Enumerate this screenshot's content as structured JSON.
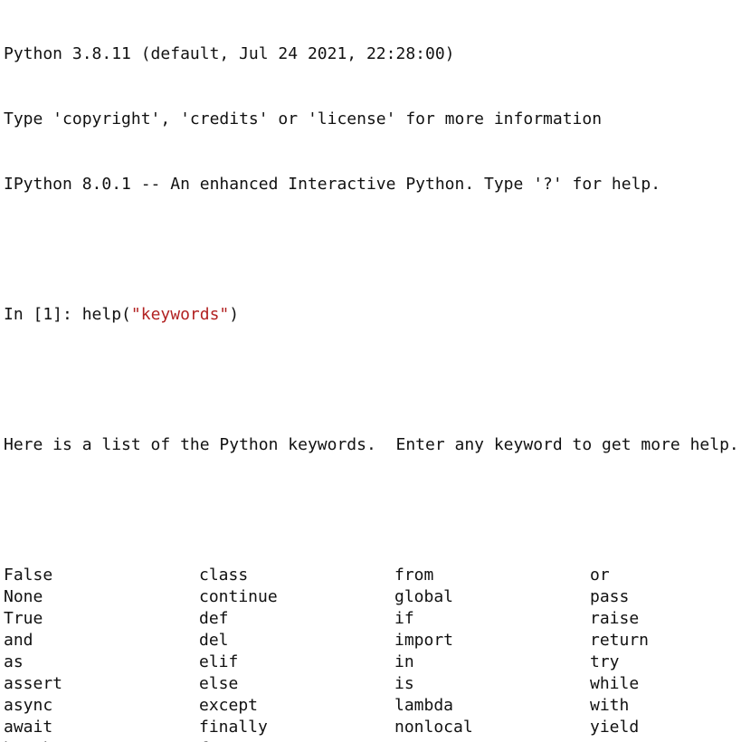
{
  "banner": {
    "line1": "Python 3.8.11 (default, Jul 24 2021, 22:28:00)",
    "line2": "Type 'copyright', 'credits' or 'license' for more information",
    "line3": "IPython 8.0.1 -- An enhanced Interactive Python. Type '?' for help."
  },
  "input": {
    "prompt": "In [1]: ",
    "code_before": "help(",
    "code_string": "\"keywords\"",
    "code_after": ")"
  },
  "output": {
    "intro": "Here is a list of the Python keywords.  Enter any keyword to get more help.",
    "columns": [
      [
        "False",
        "None",
        "True",
        "and",
        "as",
        "assert",
        "async",
        "await",
        "break"
      ],
      [
        "class",
        "continue",
        "def",
        "del",
        "elif",
        "else",
        "except",
        "finally",
        "for"
      ],
      [
        "from",
        "global",
        "if",
        "import",
        "in",
        "is",
        "lambda",
        "nonlocal",
        "not"
      ],
      [
        "or",
        "pass",
        "raise",
        "return",
        "try",
        "while",
        "with",
        "yield"
      ]
    ]
  },
  "colors": {
    "text": "#111111",
    "string_literal": "#b22222",
    "background": "#ffffff"
  }
}
